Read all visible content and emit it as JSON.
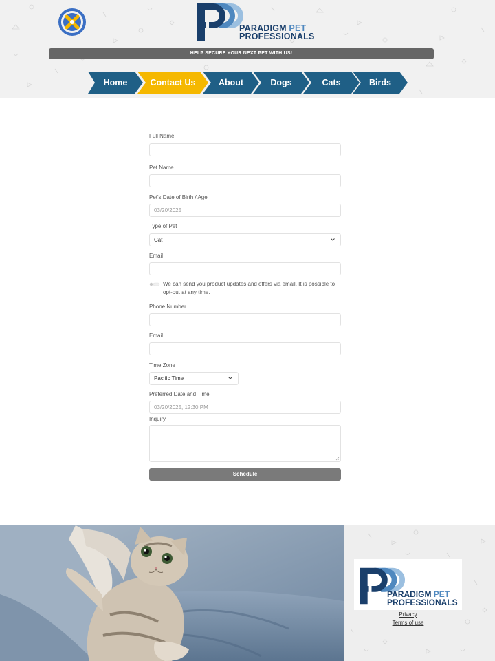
{
  "header": {
    "brand_line1_a": "PARADIGM",
    "brand_line1_b": "PET",
    "brand_line2": "PROFESSIONALS",
    "banner": "HELP SECURE YOUR NEXT PET WITH US!",
    "logo_icon": "paw-x-icon"
  },
  "nav": {
    "items": [
      {
        "label": "Home",
        "active": false
      },
      {
        "label": "Contact Us",
        "active": true
      },
      {
        "label": "About",
        "active": false
      },
      {
        "label": "Dogs",
        "active": false
      },
      {
        "label": "Cats",
        "active": false
      },
      {
        "label": "Birds",
        "active": false
      }
    ],
    "colors": {
      "default": "#1f5f86",
      "active": "#f5b800"
    }
  },
  "form": {
    "full_name_label": "Full Name",
    "full_name_value": "",
    "pet_name_label": "Pet Name",
    "pet_name_value": "",
    "dob_label": "Pet's Date of Birth / Age",
    "dob_value": "03/20/2025",
    "type_label": "Type of Pet",
    "type_value": "Cat",
    "email_label": "Email",
    "email_value": "",
    "consent_text": "We can send you product updates and offers via email. It is possible to opt-out at any time.",
    "phone_label": "Phone Number",
    "phone_value": "",
    "email2_label": "Email",
    "email2_value": "",
    "timezone_label": "Time Zone",
    "timezone_value": "Pacific Time",
    "pref_label": "Preferred Date and Time",
    "pref_value": "03/20/2025, 12:30 PM",
    "inquiry_label": "Inquiry",
    "inquiry_value": "",
    "submit_label": "Schedule"
  },
  "footer": {
    "brand_line1_a": "PARADIGM",
    "brand_line1_b": "PET",
    "brand_line2": "PROFESSIONALS",
    "privacy": "Privacy",
    "terms": "Terms of use"
  },
  "colors": {
    "brand_dark": "#1a3f6b",
    "brand_light": "#4f88bf",
    "accent": "#f5b800",
    "nav_blue": "#1f5f86",
    "button": "#7a7a7a"
  }
}
